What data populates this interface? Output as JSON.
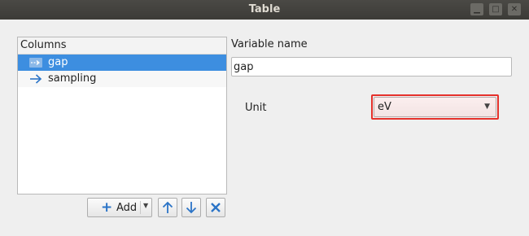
{
  "window": {
    "title": "Table"
  },
  "columns": {
    "header": "Columns",
    "items": [
      {
        "label": "gap",
        "icon": "dashed-arrow-icon",
        "selected": true
      },
      {
        "label": "sampling",
        "icon": "arrow-right-icon",
        "selected": false
      }
    ]
  },
  "toolbar": {
    "add_label": "Add",
    "add_icon": "plus-icon",
    "up_icon": "arrow-up-icon",
    "down_icon": "arrow-down-icon",
    "delete_icon": "delete-x-icon"
  },
  "form": {
    "variable_name_label": "Variable name",
    "variable_name_value": "gap",
    "unit_label": "Unit",
    "unit_value": "eV"
  },
  "colors": {
    "selection": "#3d8ee0",
    "accent_blue": "#2b74c7",
    "highlight_red": "#e5312b"
  }
}
